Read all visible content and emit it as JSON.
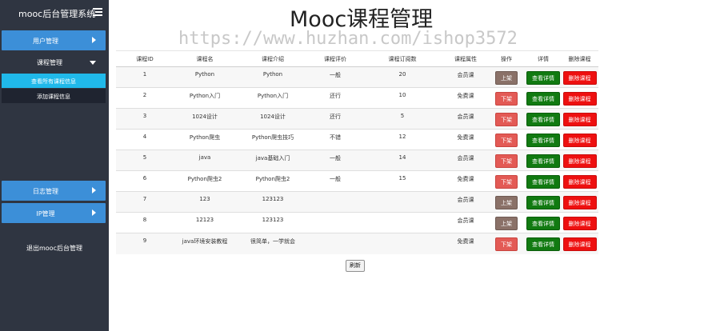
{
  "sidebar": {
    "brand": "mooc后台管理系统",
    "menu_icon": "menu-hamburger-icon",
    "items": [
      {
        "label": "用户管理",
        "icon": "chevron-right-icon"
      },
      {
        "label": "课程管理",
        "icon": "chevron-down-icon"
      },
      {
        "label": "日志管理",
        "icon": "chevron-right-icon"
      },
      {
        "label": "IP管理",
        "icon": "chevron-right-icon"
      }
    ],
    "sub_items": [
      {
        "label": "查看所有课程信息",
        "active": true
      },
      {
        "label": "添加课程信息",
        "active": false
      }
    ],
    "logout": "退出mooc后台管理",
    "colors": {
      "bg": "#2f3541",
      "nav": "#3c8fd8",
      "active": "#20b9ea"
    }
  },
  "main": {
    "title": "Mooc课程管理",
    "watermark": "https://www.huzhan.com/ishop3572",
    "table": {
      "headers": [
        "课程ID",
        "课程名",
        "课程介绍",
        "课程评价",
        "课程订阅数",
        "课程属性",
        "操作",
        "详情",
        "删除课程"
      ],
      "rows": [
        {
          "id": "1",
          "name": "Python",
          "intro": "Python",
          "rating": "一般",
          "subs": "20",
          "attr": "会员课",
          "action": "上架",
          "detail": "查看详情",
          "delete": "删除课程"
        },
        {
          "id": "2",
          "name": "Python入门",
          "intro": "Python入门",
          "rating": "还行",
          "subs": "10",
          "attr": "免费课",
          "action": "下架",
          "detail": "查看详情",
          "delete": "删除课程"
        },
        {
          "id": "3",
          "name": "1024设计",
          "intro": "1024设计",
          "rating": "还行",
          "subs": "5",
          "attr": "会员课",
          "action": "下架",
          "detail": "查看详情",
          "delete": "删除课程"
        },
        {
          "id": "4",
          "name": "Python爬虫",
          "intro": "Python爬虫技巧",
          "rating": "不错",
          "subs": "12",
          "attr": "免费课",
          "action": "下架",
          "detail": "查看详情",
          "delete": "删除课程"
        },
        {
          "id": "5",
          "name": "java",
          "intro": "java基础入门",
          "rating": "一般",
          "subs": "14",
          "attr": "会员课",
          "action": "下架",
          "detail": "查看详情",
          "delete": "删除课程"
        },
        {
          "id": "6",
          "name": "Python爬虫2",
          "intro": "Python爬虫2",
          "rating": "一般",
          "subs": "15",
          "attr": "免费课",
          "action": "下架",
          "detail": "查看详情",
          "delete": "删除课程"
        },
        {
          "id": "7",
          "name": "123",
          "intro": "123123",
          "rating": "",
          "subs": "",
          "attr": "会员课",
          "action": "上架",
          "detail": "查看详情",
          "delete": "删除课程"
        },
        {
          "id": "8",
          "name": "12123",
          "intro": "123123",
          "rating": "",
          "subs": "",
          "attr": "会员课",
          "action": "上架",
          "detail": "查看详情",
          "delete": "删除课程"
        },
        {
          "id": "9",
          "name": "java环境安装教程",
          "intro": "很简单，一学就会",
          "rating": "",
          "subs": "",
          "attr": "免费课",
          "action": "下架",
          "detail": "查看详情",
          "delete": "删除课程"
        }
      ]
    },
    "refresh_label": "刷新",
    "colors": {
      "shelf_on": "#8a7168",
      "shelf_off": "#e35a55",
      "view": "#117a11",
      "delete": "#ee1010"
    }
  }
}
